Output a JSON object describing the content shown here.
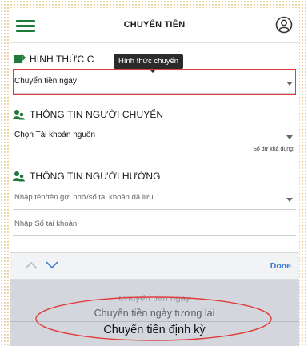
{
  "header": {
    "title": "CHUYỂN TIỀN",
    "menu_icon": "hamburger-icon",
    "account_icon": "user-circle-icon"
  },
  "transfer_type": {
    "heading": "HÌNH THỨC C",
    "tooltip": "Hình thức chuyển",
    "selected_value": "Chuyển tiền ngay",
    "highlight_color": "#e23b3b"
  },
  "sender": {
    "heading": "THÔNG TIN NGƯỜI CHUYỂN",
    "source_account_value": "Chọn Tài khoản nguồn",
    "balance_label": "Số dư khả dụng:"
  },
  "receiver": {
    "heading": "THÔNG TIN NGƯỜI HƯỞNG",
    "saved_name_placeholder": "Nhập tên/tên gợi nhớ/số tài khoản đã lưu",
    "account_number_placeholder": "Nhập Số tài khoản"
  },
  "picker": {
    "done_label": "Done",
    "options": [
      "Chuyển tiền ngay",
      "Chuyển tiền ngày tương lai",
      "Chuyển tiền định kỳ"
    ],
    "accent_color": "#3c7bd6"
  },
  "brand_color": "#1f7a3a"
}
